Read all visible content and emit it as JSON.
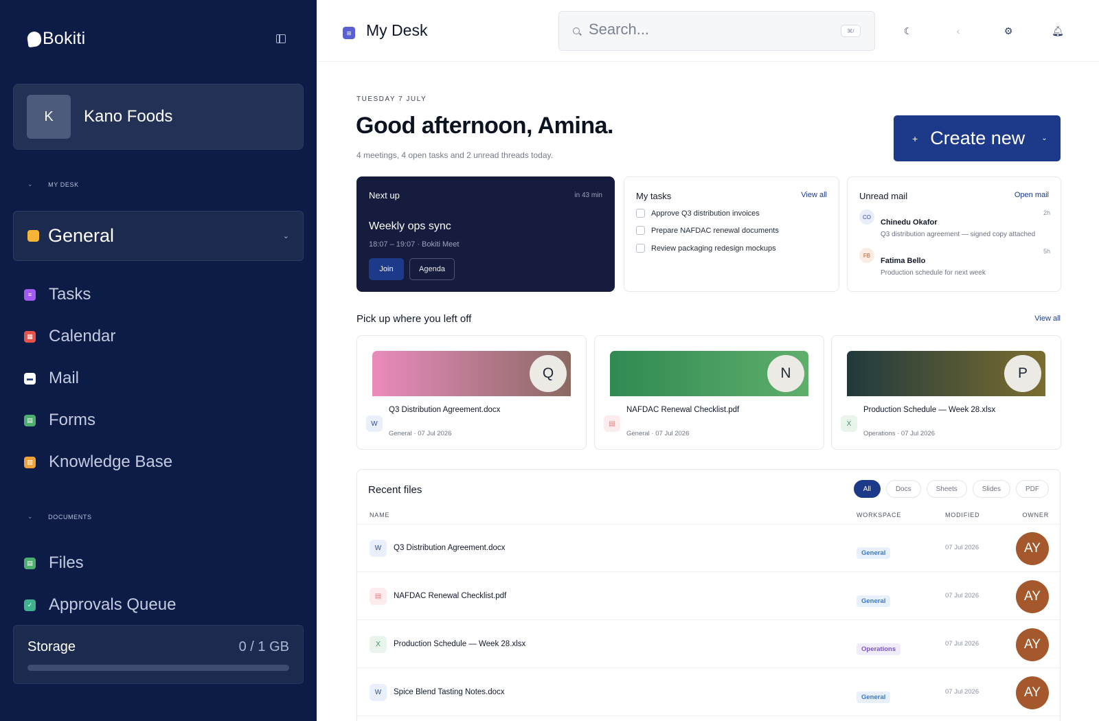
{
  "sidebar": {
    "brand": "Bokiti",
    "workspace": {
      "initial": "K",
      "name": "Kano Foods"
    },
    "section_my_desk": "MY DESK",
    "general": {
      "label": "General"
    },
    "items": [
      {
        "label": "Tasks",
        "icon": "list-icon",
        "color": "#a35af0"
      },
      {
        "label": "Calendar",
        "icon": "calendar-icon",
        "color": "#e5534b"
      },
      {
        "label": "Mail",
        "icon": "mail-icon",
        "color": "#ffffff"
      },
      {
        "label": "Forms",
        "icon": "form-icon",
        "color": "#4caf6f"
      },
      {
        "label": "Knowledge Base",
        "icon": "book-icon",
        "color": "#f0a23a"
      }
    ],
    "section_documents": "DOCUMENTS",
    "doc_items": [
      {
        "label": "Files",
        "icon": "file-icon",
        "color": "#4caf6f"
      },
      {
        "label": "Approvals Queue",
        "icon": "check-icon",
        "color": "#3fb28f"
      }
    ],
    "storage": {
      "title": "Storage",
      "value": "0 / 1 GB",
      "used_fraction": 0
    }
  },
  "header": {
    "title": "My Desk",
    "search_placeholder": "Search...",
    "search_shortcut": "⌘/"
  },
  "main": {
    "date": "TUESDAY 7 JULY",
    "greeting": "Good afternoon, Amina.",
    "summary": "4 meetings, 4 open tasks and 2 unread threads today.",
    "create_label": "Create new",
    "next_up": {
      "heading": "Next up",
      "eta": "in 43 min",
      "title": "Weekly ops sync",
      "time": "18:07 – 19:07 · Bokiti Meet",
      "join_label": "Join",
      "agenda_label": "Agenda"
    },
    "tasks": {
      "heading": "My tasks",
      "link": "View all",
      "items": [
        "Approve Q3 distribution invoices",
        "Prepare NAFDAC renewal documents",
        "Review packaging redesign mockups"
      ]
    },
    "mail": {
      "heading": "Unread mail",
      "link": "Open mail",
      "items": [
        {
          "initials": "CO",
          "from": "Chinedu Okafor",
          "subject": "Q3 distribution agreement — signed copy attached",
          "time": "2h"
        },
        {
          "initials": "FB",
          "from": "Fatima Bello",
          "subject": "Production schedule for next week",
          "time": "5h"
        }
      ]
    },
    "pickup": {
      "title": "Pick up where you left off",
      "link": "View all",
      "items": [
        {
          "initial": "Q",
          "type": "W",
          "name": "Q3 Distribution Agreement.docx",
          "meta": "General · 07 Jul 2026"
        },
        {
          "initial": "N",
          "type": "▤",
          "name": "NAFDAC Renewal Checklist.pdf",
          "meta": "General · 07 Jul 2026"
        },
        {
          "initial": "P",
          "type": "X",
          "name": "Production Schedule — Week 28.xlsx",
          "meta": "Operations · 07 Jul 2026"
        }
      ]
    },
    "recent": {
      "title": "Recent files",
      "filters": [
        "All",
        "Docs",
        "Sheets",
        "Slides",
        "PDF"
      ],
      "columns": {
        "name": "NAME",
        "workspace": "WORKSPACE",
        "modified": "MODIFIED",
        "owner": "OWNER"
      },
      "rows": [
        {
          "type": "W",
          "name": "Q3 Distribution Agreement.docx",
          "workspace": "General",
          "modified": "07 Jul 2026",
          "owner": "AY"
        },
        {
          "type": "▤",
          "name": "NAFDAC Renewal Checklist.pdf",
          "workspace": "General",
          "modified": "07 Jul 2026",
          "owner": "AY"
        },
        {
          "type": "X",
          "name": "Production Schedule — Week 28.xlsx",
          "workspace": "Operations",
          "modified": "07 Jul 2026",
          "owner": "AY"
        },
        {
          "type": "W",
          "name": "Spice Blend Tasting Notes.docx",
          "workspace": "General",
          "modified": "07 Jul 2026",
          "owner": "AY"
        }
      ]
    }
  }
}
